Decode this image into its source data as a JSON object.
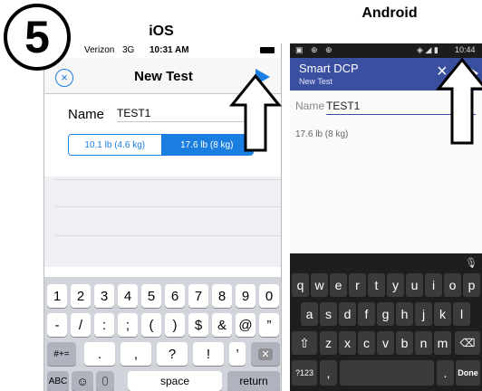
{
  "step_number": "5",
  "labels": {
    "ios": "iOS",
    "android": "Android"
  },
  "ios": {
    "status": {
      "carrier": "Verizon",
      "network": "3G",
      "time": "10:31 AM"
    },
    "nav": {
      "title": "New Test"
    },
    "name_label": "Name",
    "name_value": "TEST1",
    "weights": [
      "10.1 lb (4.6 kg)",
      "17.6 lb (8 kg)"
    ],
    "selected_weight": "17.6 lb (8 kg)",
    "keyboard": {
      "row1": [
        "1",
        "2",
        "3",
        "4",
        "5",
        "6",
        "7",
        "8",
        "9",
        "0"
      ],
      "row2": [
        "-",
        "/",
        ":",
        ";",
        "(",
        ")",
        "$",
        "&",
        "@",
        "”"
      ],
      "row3_left": "#+=",
      "row3": [
        ".",
        ",",
        "?",
        "!",
        "’"
      ],
      "row4": {
        "abc": "ABC",
        "space": "space",
        "return": "return"
      }
    }
  },
  "android": {
    "status": {
      "time": "10:44"
    },
    "app_title": "Smart DCP",
    "app_subtitle": "New Test",
    "name_label": "Name",
    "name_value": "TEST1",
    "weight_value": "17.6 lb (8 kg)",
    "keyboard": {
      "row1": [
        "q",
        "w",
        "e",
        "r",
        "t",
        "y",
        "u",
        "i",
        "o",
        "p"
      ],
      "row2": [
        "a",
        "s",
        "d",
        "f",
        "g",
        "h",
        "j",
        "k",
        "l"
      ],
      "row3": [
        "z",
        "x",
        "c",
        "v",
        "b",
        "n",
        "m"
      ],
      "row4": {
        "sym": "?123",
        "comma": ",",
        "period": ".",
        "done": "Done"
      }
    }
  }
}
